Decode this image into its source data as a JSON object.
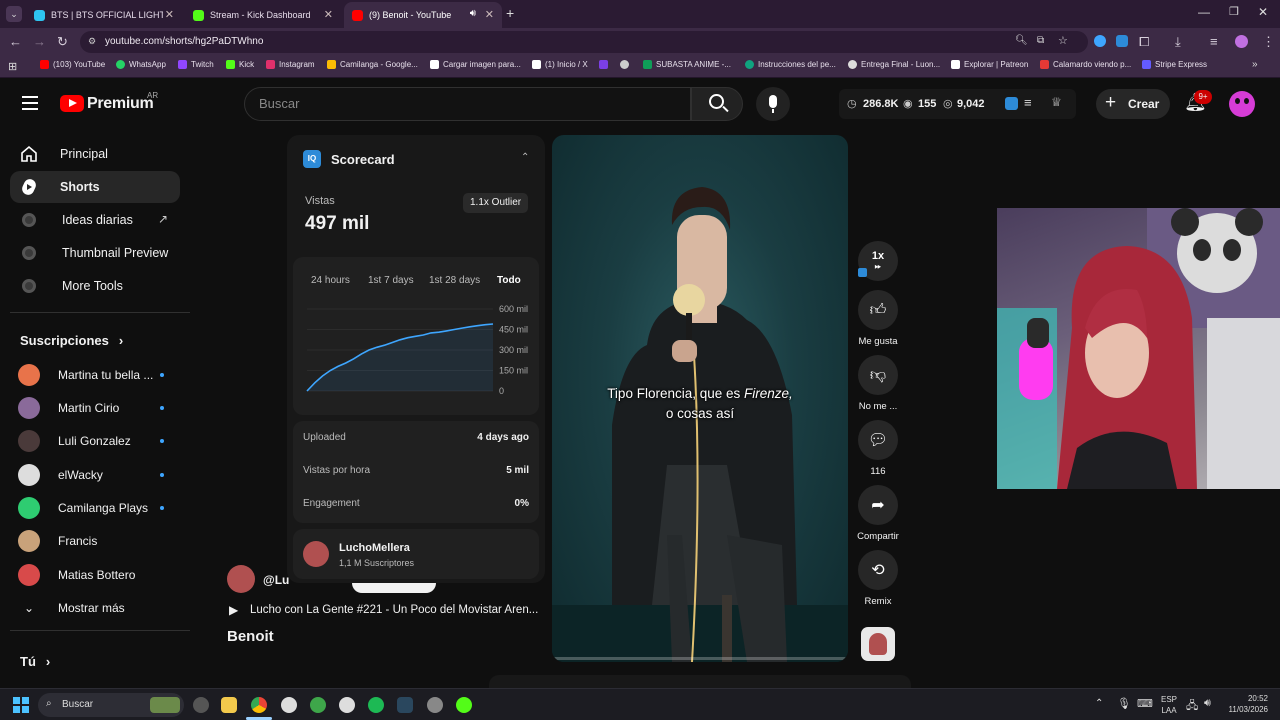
{
  "browser": {
    "tabs": [
      {
        "title": "BTS | BTS OFFICIAL LIGHT STICK",
        "color": "#2ec4f0"
      },
      {
        "title": "Stream - Kick Dashboard",
        "color": "#53fc18"
      },
      {
        "title": "(9) Benoit - YouTube",
        "color": "#ff0000"
      }
    ],
    "url": "youtube.com/shorts/hg2PaDTWhno",
    "bookmarks": [
      {
        "label": "(103) YouTube",
        "color": "#ff0000"
      },
      {
        "label": "WhatsApp",
        "color": "#25d366"
      },
      {
        "label": "Twitch",
        "color": "#9146ff"
      },
      {
        "label": "Kick",
        "color": "#53fc18"
      },
      {
        "label": "Instagram",
        "color": "#e1306c"
      },
      {
        "label": "Camilanga - Google...",
        "color": "#fbbc04"
      },
      {
        "label": "Cargar imagen para...",
        "color": "#ffffff"
      },
      {
        "label": "(1) Inicio / X",
        "color": "#ffffff"
      },
      {
        "label": "",
        "color": "#7b3fe4"
      },
      {
        "label": "",
        "color": "#cccccc"
      },
      {
        "label": "SUBASTA ANIME -...",
        "color": "#0f9d58"
      },
      {
        "label": "Instrucciones del pe...",
        "color": "#10a37f"
      },
      {
        "label": "Entrega Final - Luon...",
        "color": "#dddddd"
      },
      {
        "label": "Explorar | Patreon",
        "color": "#ffffff"
      },
      {
        "label": "Calamardo viendo p...",
        "color": "#e53935"
      },
      {
        "label": "Stripe Express",
        "color": "#635bff"
      }
    ]
  },
  "yt": {
    "logo": "Premium",
    "region": "AR",
    "search_placeholder": "Buscar",
    "stats": {
      "views": "286.8K",
      "eye": "155",
      "watch": "9,042"
    },
    "create": "Crear",
    "notif_badge": "9+"
  },
  "sidebar": {
    "main": [
      "Principal",
      "Shorts",
      "Ideas diarias",
      "Thumbnail Preview",
      "More Tools"
    ],
    "subs_title": "Suscripciones",
    "subs": [
      {
        "name": "Martina tu bella ...",
        "color": "#e8734a"
      },
      {
        "name": "Martin Cirio",
        "color": "#8a6a9a"
      },
      {
        "name": "Luli Gonzalez",
        "color": "#4a3a3a"
      },
      {
        "name": "elWacky",
        "color": "#dddddd"
      },
      {
        "name": "Camilanga Plays",
        "color": "#2ecc71"
      },
      {
        "name": "Francis",
        "color": "#c9a27a"
      },
      {
        "name": "Matias Bottero",
        "color": "#d84a4a"
      }
    ],
    "more": "Mostrar más",
    "you": "Tú"
  },
  "scorecard": {
    "title": "Scorecard",
    "views_label": "Vistas",
    "views": "497 mil",
    "outlier": "1.1x Outlier",
    "ranges": [
      "24 hours",
      "1st 7 days",
      "1st 28 days",
      "Todo"
    ],
    "yticks": [
      "600 mil",
      "450 mil",
      "300 mil",
      "150 mil",
      "0"
    ],
    "rows": [
      {
        "label": "Uploaded",
        "value": "4 days ago"
      },
      {
        "label": "Vistas por hora",
        "value": "5 mil"
      },
      {
        "label": "Engagement",
        "value": "0%"
      }
    ],
    "channel": "LuchoMellera",
    "subscribers": "1,1 M Suscriptores"
  },
  "chart_data": {
    "type": "line",
    "x": [
      0,
      1,
      2,
      3,
      4,
      5,
      6,
      7,
      8,
      9,
      10,
      11,
      12,
      13,
      14,
      15,
      16,
      17,
      18,
      19,
      20,
      21,
      22,
      23,
      24
    ],
    "y": [
      0,
      60,
      110,
      150,
      180,
      205,
      235,
      270,
      300,
      320,
      335,
      355,
      375,
      390,
      400,
      410,
      425,
      430,
      440,
      450,
      460,
      470,
      478,
      485,
      490
    ],
    "ylim": [
      0,
      600
    ],
    "yticks": [
      "600 mil",
      "450 mil",
      "300 mil",
      "150 mil",
      "0"
    ],
    "line_color": "#3ea6ff",
    "grid": true
  },
  "video": {
    "caption1": "Tipo Florencia, que es ",
    "caption_em": "Firenze,",
    "caption2": "o cosas así",
    "handle": "@Lu",
    "playlist": "Lucho con La Gente #221 - Un Poco del Movistar Aren...",
    "title": "Benoit"
  },
  "actions": {
    "speed": "1x",
    "like": "Me gusta",
    "dislike": "No me ...",
    "comments": "116",
    "share": "Compartir",
    "remix": "Remix"
  },
  "taskbar": {
    "search": "Buscar",
    "lang1": "ESP",
    "lang2": "LAA",
    "time": "20:52",
    "date": "11/03/2026"
  }
}
